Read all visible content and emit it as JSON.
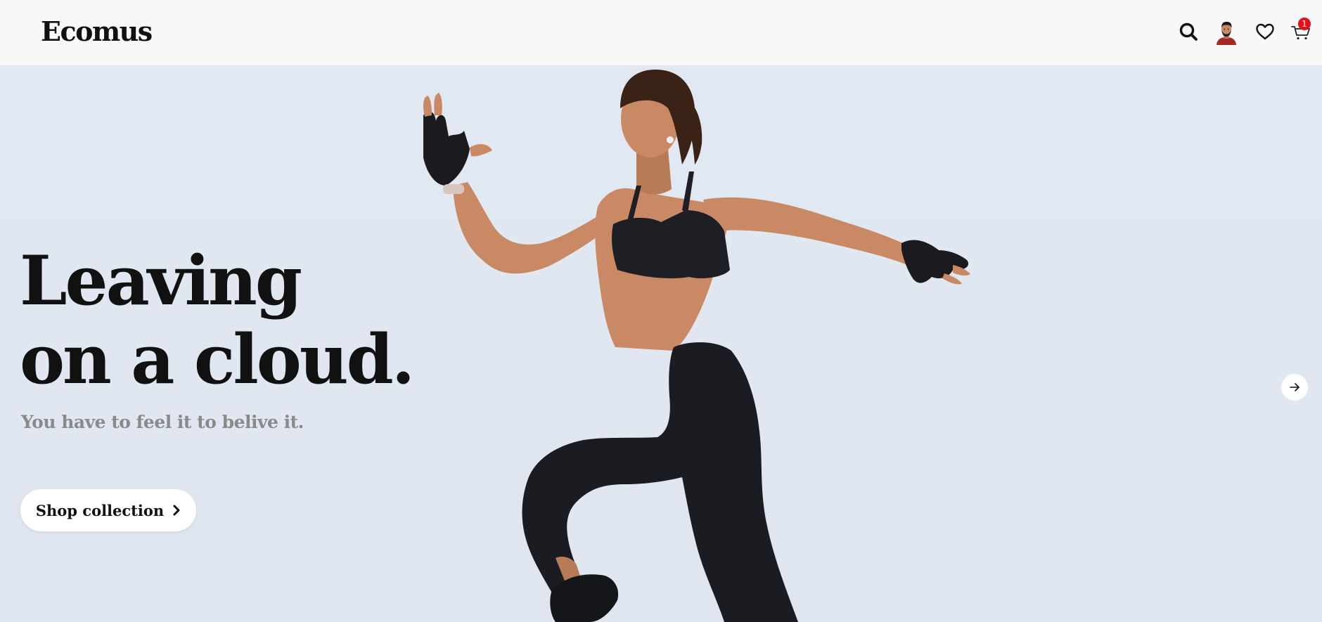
{
  "brand": {
    "name": "Ecomus"
  },
  "header": {
    "icons": [
      "search-icon",
      "account-avatar",
      "heart-icon",
      "cart-icon"
    ],
    "cart_count": "1",
    "badge_color": "#e3101e"
  },
  "hero": {
    "headline_line1": "Leaving",
    "headline_line2": "on a cloud.",
    "subtitle": "You have to feel it to belive it.",
    "cta_label": "Shop collection",
    "background_color": "#e1e8f1",
    "image_description_icon": "athlete-image"
  }
}
